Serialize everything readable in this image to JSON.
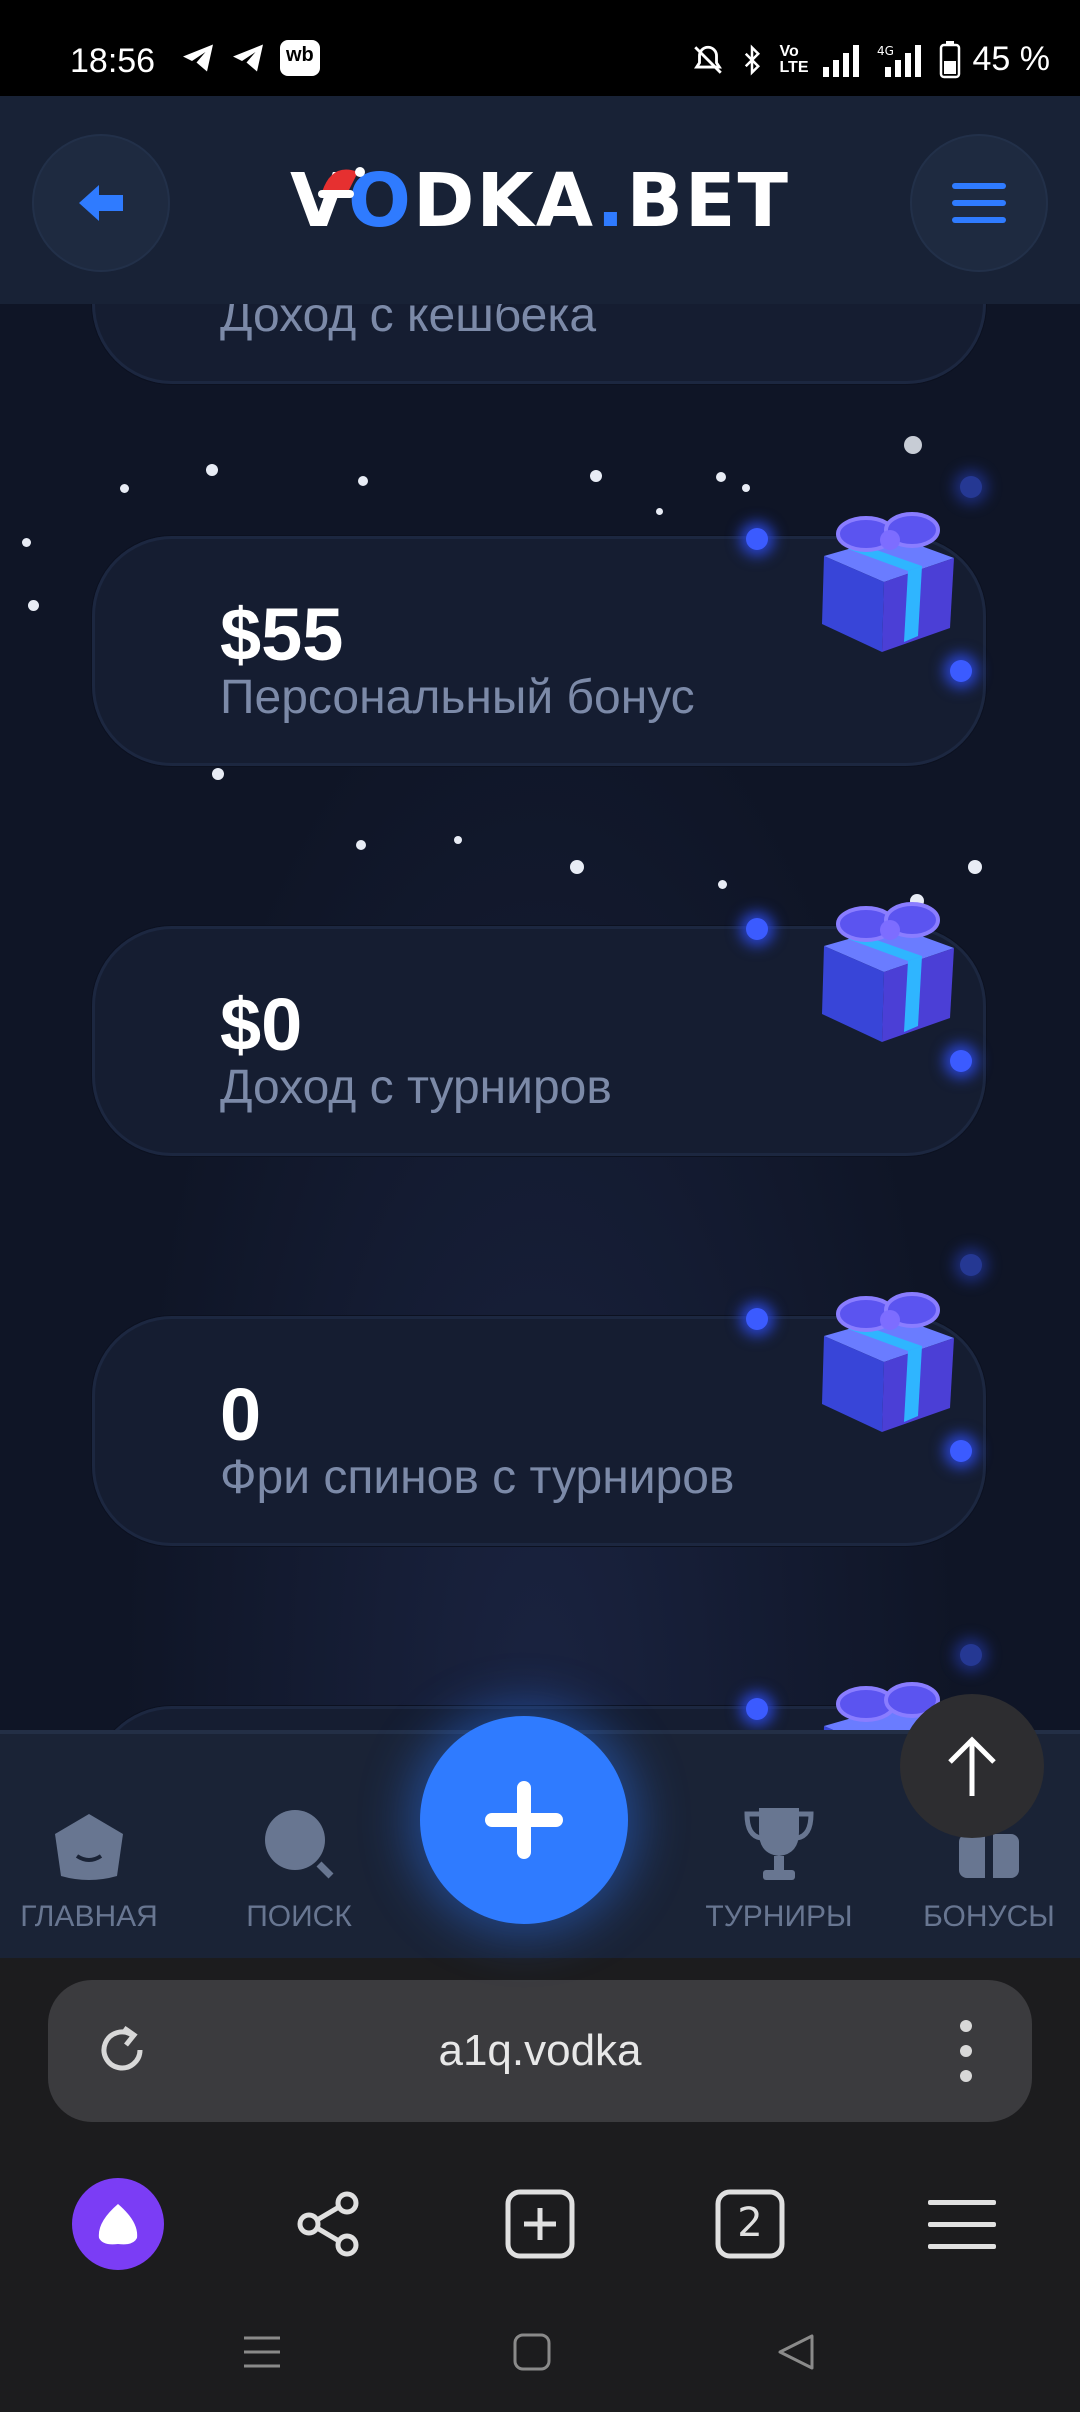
{
  "status_bar": {
    "time": "18:56",
    "battery": "45 %",
    "icons": [
      "telegram-icon",
      "telegram-icon",
      "wb-icon",
      "mute-icon",
      "bluetooth-icon",
      "volte-icon",
      "signal-icon",
      "4g-signal-icon",
      "battery-icon"
    ],
    "wb_label": "wb"
  },
  "header": {
    "logo_pre": "V",
    "logo_o": "O",
    "logo_mid": "DKA",
    "logo_dot": ".",
    "logo_post": "BET"
  },
  "cards": [
    {
      "amount": "",
      "label": "Доход с кешбека"
    },
    {
      "amount": "$55",
      "label": "Персональный бонус"
    },
    {
      "amount": "$0",
      "label": "Доход с турниров"
    },
    {
      "amount": "0",
      "label": "Фри спинов с турниров"
    }
  ],
  "bottom_nav": {
    "home": "ГЛАВНАЯ",
    "search": "ПОИСК",
    "tournaments": "ТУРНИРЫ",
    "bonuses": "БОНУСЫ"
  },
  "browser": {
    "url": "a1q.vodka",
    "tabs_count": "2"
  },
  "colors": {
    "accent": "#2f7bff",
    "background": "#0f1526",
    "card": "#151d31",
    "label": "#7c8aa8"
  }
}
